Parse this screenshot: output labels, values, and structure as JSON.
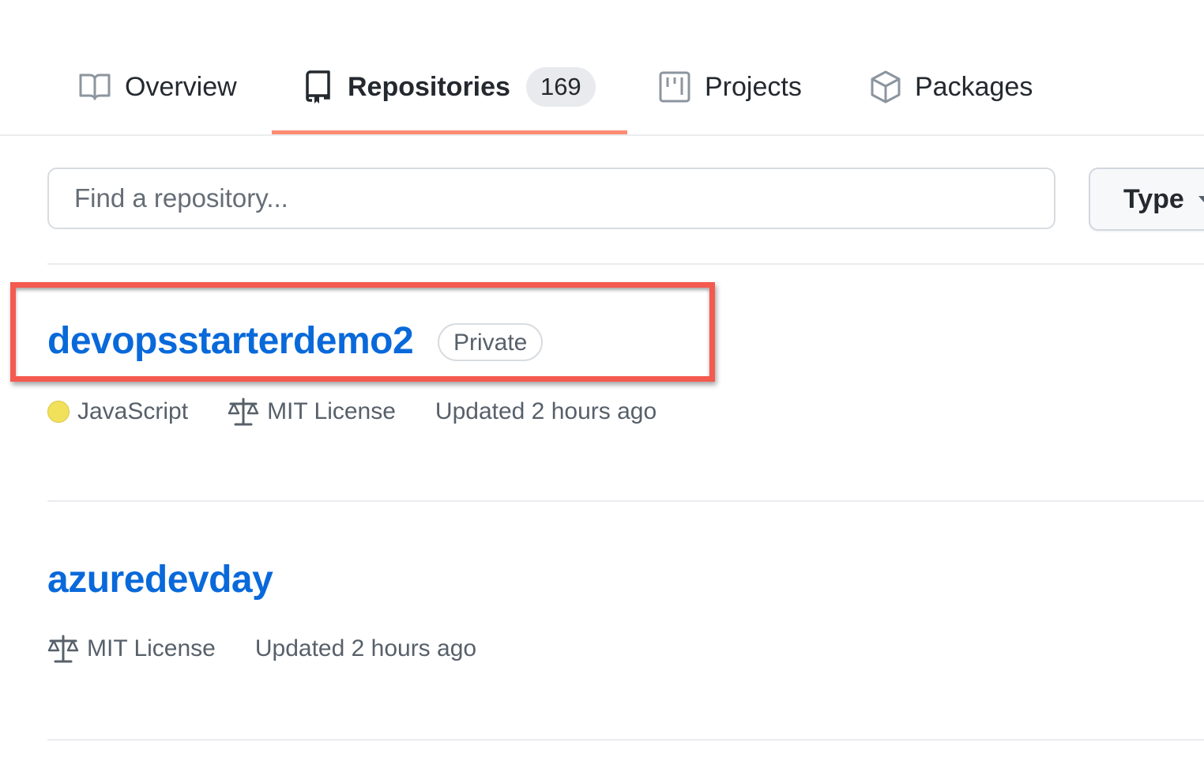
{
  "tabs": [
    {
      "label": "Overview",
      "icon": "book-icon",
      "selected": false
    },
    {
      "label": "Repositories",
      "icon": "repo-icon",
      "selected": true,
      "counter": "169"
    },
    {
      "label": "Projects",
      "icon": "project-icon",
      "selected": false
    },
    {
      "label": "Packages",
      "icon": "package-icon",
      "selected": false
    }
  ],
  "search": {
    "placeholder": "Find a repository...",
    "value": ""
  },
  "filters": {
    "type_label": "Type"
  },
  "repositories": [
    {
      "name": "devopsstarterdemo2",
      "visibility": "Private",
      "language": "JavaScript",
      "language_color": "#f1e05a",
      "license": "MIT License",
      "updated": "Updated 2 hours ago",
      "highlighted": true
    },
    {
      "name": "azuredevday",
      "license": "MIT License",
      "updated": "Updated 2 hours ago",
      "highlighted": false
    }
  ],
  "colors": {
    "link": "#0969da",
    "selected_tab_underline": "#fd8c73",
    "highlight_box": "#f45a4f"
  }
}
